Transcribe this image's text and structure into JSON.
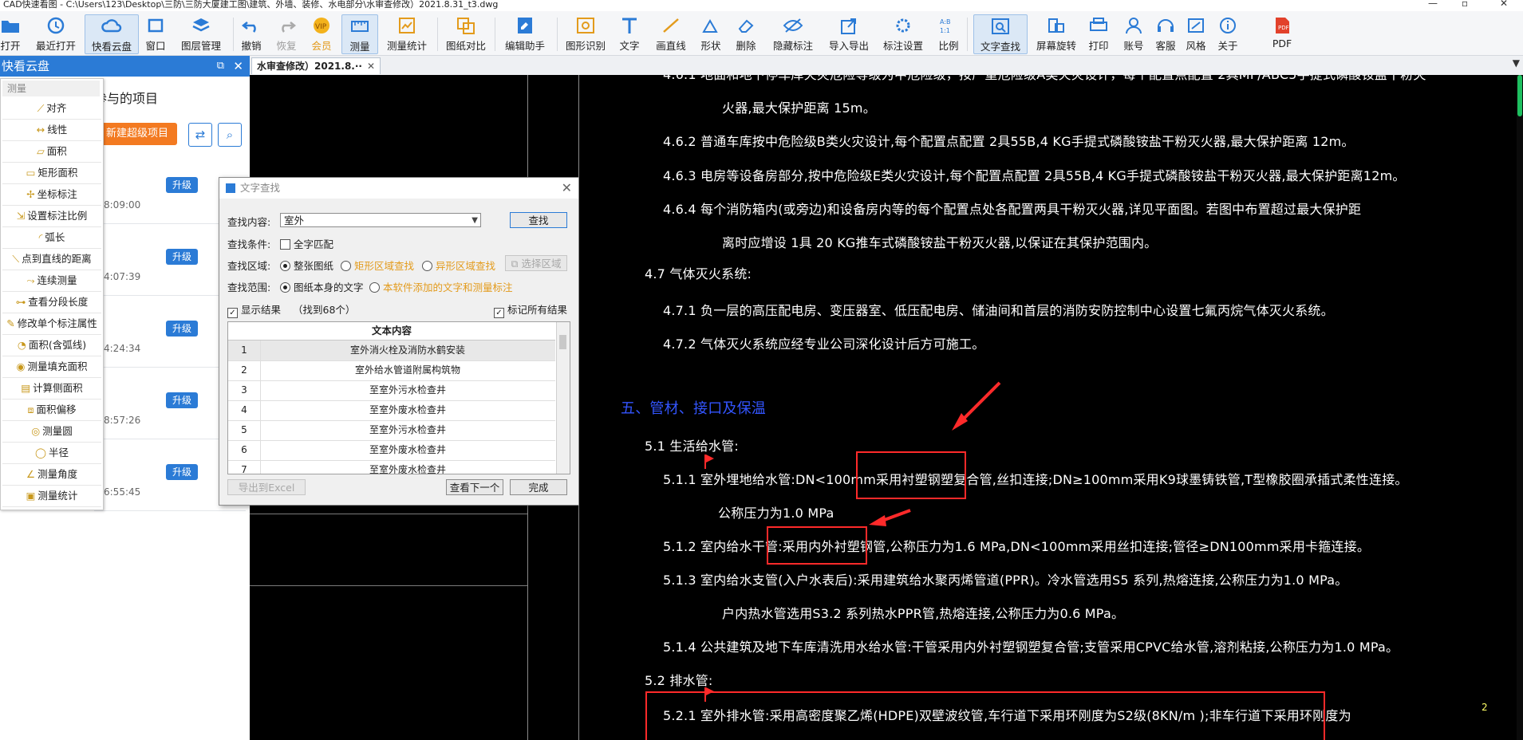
{
  "window": {
    "title": "CAD快速看图 - C:\\Users\\123\\Desktop\\三防\\三防大厦建工图\\建筑、外墙、装修、水电部分\\水审查修改）2021.8.31_t3.dwg"
  },
  "toolbar": {
    "open": "打开",
    "recent": "最近打开",
    "cloud": "快看云盘",
    "window": "窗口",
    "layers": "图层管理",
    "undo": "撤销",
    "redo": "恢复",
    "vip": "会员",
    "measure": "测量",
    "measure_stats": "测量统计",
    "compare": "图纸对比",
    "edit_helper": "编辑助手",
    "recognize": "图形识别",
    "text": "文字",
    "line": "画直线",
    "shape": "形状",
    "delete": "删除",
    "hide_markup": "隐藏标注",
    "import_export": "导入导出",
    "markup_settings": "标注设置",
    "ratio": "比例",
    "text_search": "文字查找",
    "rotate": "屏幕旋转",
    "print": "打印",
    "account": "账号",
    "service": "客服",
    "style": "风格",
    "about": "关于",
    "pdf": "PDF"
  },
  "left_panel": {
    "title": "快看云盘",
    "projects_title": "参与的项目",
    "new_project": "新建超级项目",
    "upgrade_label": "升级",
    "cards": [
      {
        "time": "8:09:00"
      },
      {
        "time": "4:07:39"
      },
      {
        "time": "4:24:34"
      },
      {
        "time": "8:57:26"
      },
      {
        "time": "6:55:45"
      }
    ]
  },
  "measure_menu": {
    "title": "测量",
    "items": [
      "对齐",
      "线性",
      "面积",
      "矩形面积",
      "坐标标注",
      "设置标注比例",
      "弧长",
      "点到直线的距离",
      "连续测量",
      "查看分段长度",
      "修改单个标注属性",
      "面积(含弧线)",
      "测量填充面积",
      "计算侧面积",
      "面积偏移",
      "测量圆",
      "半径",
      "测量角度",
      "测量统计"
    ]
  },
  "tab": {
    "label": "水审查修改）2021.8.··"
  },
  "drawing": {
    "lines": [
      "4.6.1  地面和地下停车库火灾危险等级为中危险级，按严重危险级A类火灾设计，每个配置点配置 2具MF/ABC5手提式磷酸铵盐干粉灭",
      "火器,最大保护距离 15m。",
      "4.6.2  普通车库按中危险级B类火灾设计,每个配置点配置 2具55B,4 KG手提式磷酸铵盐干粉灭火器,最大保护距离 12m。",
      "4.6.3  电房等设备房部分,按中危险级E类火灾设计,每个配置点配置 2具55B,4 KG手提式磷酸铵盐干粉灭火器,最大保护距离12m。",
      "4.6.4  每个消防箱内(或旁边)和设备房内等的每个配置点处各配置两具干粉灭火器,详见平面图。若图中布置超过最大保护距",
      "离时应增设 1具 20 KG推车式磷酸铵盐干粉灭火器,以保证在其保护范围内。",
      "4.7  气体灭火系统:",
      "4.7.1  负一层的高压配电房、变压器室、低压配电房、储油间和首层的消防安防控制中心设置七氟丙烷气体灭火系统。",
      "4.7.2  气体灭火系统应经专业公司深化设计后方可施工。",
      "五、管材、接口及保温",
      "5.1  生活给水管:",
      "5.1.1  室外埋地给水管:DN<100mm采用衬塑钢塑复合管,丝扣连接;DN≥100mm采用K9球墨铸铁管,T型橡胶圈承插式柔性连接。",
      "公称压力为1.0 MPa",
      "5.1.2  室内给水干管:采用内外衬塑钢管,公称压力为1.6 MPa,DN<100mm采用丝扣连接;管径≥DN100mm采用卡箍连接。",
      "5.1.3  室内给水支管(入户水表后):采用建筑给水聚丙烯管道(PPR)。冷水管选用S5 系列,热熔连接,公称压力为1.0 MPa。",
      "户内热水管选用S3.2 系列热水PPR管,热熔连接,公称压力为0.6 MPa。",
      "5.1.4  公共建筑及地下车库清洗用水给水管:干管采用内外衬塑钢塑复合管;支管采用CPVC给水管,溶剂粘接,公称压力为1.0 MPa。",
      "5.2  排水管:",
      "5.2.1  室外排水管:采用高密度聚乙烯(HDPE)双壁波纹管,车行道下采用环刚度为S2级(8KN/m );非车行道下采用环刚度为"
    ],
    "page_number": "2"
  },
  "find_dialog": {
    "title": "文字查找",
    "content_label": "查找内容:",
    "content_value": "室外",
    "find_button": "查找",
    "condition_label": "查找条件:",
    "full_match": "全字匹配",
    "area_label": "查找区域:",
    "area_whole": "整张图纸",
    "area_rect": "矩形区域查找",
    "area_irregular": "异形区域查找",
    "select_area": "选择区域",
    "scope_label": "查找范围:",
    "scope_drawing": "图纸本身的文字",
    "scope_added": "本软件添加的文字和测量标注",
    "show_results": "显示结果",
    "found_count": "（找到68个）",
    "mark_all": "标记所有结果",
    "column_header": "文本内容",
    "results": [
      {
        "n": "1",
        "text": "室外消火栓及消防水鹤安装"
      },
      {
        "n": "2",
        "text": "室外给水管道附属构筑物"
      },
      {
        "n": "3",
        "text": "至室外污水检查井"
      },
      {
        "n": "4",
        "text": "至室外废水检查井"
      },
      {
        "n": "5",
        "text": "至室外污水检查井"
      },
      {
        "n": "6",
        "text": "至室外废水检查井"
      },
      {
        "n": "7",
        "text": "至室外废水检查井"
      }
    ],
    "export_excel": "导出到Excel",
    "next": "查看下一个",
    "done": "完成"
  }
}
